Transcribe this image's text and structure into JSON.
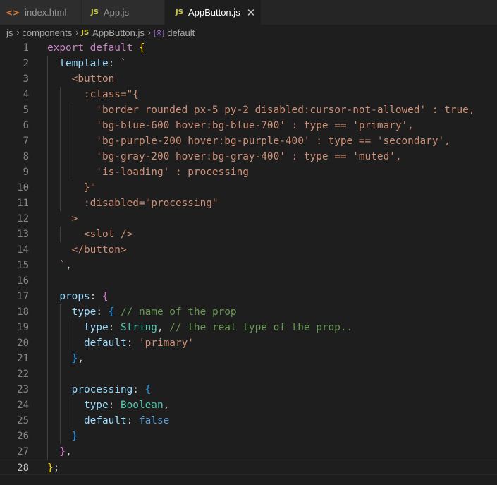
{
  "tabs": [
    {
      "icon": "<>",
      "label": "index.html",
      "active": false
    },
    {
      "icon": "JS",
      "label": "App.js",
      "active": false
    },
    {
      "icon": "JS",
      "label": "AppButton.js",
      "active": true
    }
  ],
  "breadcrumb": {
    "seg1": "js",
    "seg2": "components",
    "file_icon": "JS",
    "file": "AppButton.js",
    "symbol": "default"
  },
  "lines": [
    {
      "n": "1",
      "tokens": [
        [
          "export",
          "kw"
        ],
        [
          " ",
          ""
        ],
        [
          "default",
          "kw"
        ],
        [
          " ",
          ""
        ],
        [
          "{",
          "br1"
        ]
      ]
    },
    {
      "n": "2",
      "tokens": [
        [
          "  ",
          ""
        ],
        [
          "template",
          "prop"
        ],
        [
          ": ",
          ""
        ],
        [
          "`",
          "str"
        ]
      ]
    },
    {
      "n": "3",
      "tokens": [
        [
          "    <button",
          "str"
        ]
      ]
    },
    {
      "n": "4",
      "tokens": [
        [
          "      :class=\"{",
          "str"
        ]
      ]
    },
    {
      "n": "5",
      "tokens": [
        [
          "        'border rounded px-5 py-2 disabled:cursor-not-allowed' : true,",
          "str"
        ]
      ]
    },
    {
      "n": "6",
      "tokens": [
        [
          "        'bg-blue-600 hover:bg-blue-700' : type == 'primary',",
          "str"
        ]
      ]
    },
    {
      "n": "7",
      "tokens": [
        [
          "        'bg-purple-200 hover:bg-purple-400' : type == 'secondary',",
          "str"
        ]
      ]
    },
    {
      "n": "8",
      "tokens": [
        [
          "        'bg-gray-200 hover:bg-gray-400' : type == 'muted',",
          "str"
        ]
      ]
    },
    {
      "n": "9",
      "tokens": [
        [
          "        'is-loading' : processing",
          "str"
        ]
      ]
    },
    {
      "n": "10",
      "tokens": [
        [
          "      }\"",
          "str"
        ]
      ]
    },
    {
      "n": "11",
      "tokens": [
        [
          "      :disabled=\"processing\"",
          "str"
        ]
      ]
    },
    {
      "n": "12",
      "tokens": [
        [
          "    >",
          "str"
        ]
      ]
    },
    {
      "n": "13",
      "tokens": [
        [
          "      <slot />",
          "str"
        ]
      ]
    },
    {
      "n": "14",
      "tokens": [
        [
          "    </button>",
          "str"
        ]
      ]
    },
    {
      "n": "15",
      "tokens": [
        [
          "  `",
          "str"
        ],
        [
          ",",
          ""
        ]
      ]
    },
    {
      "n": "16",
      "tokens": []
    },
    {
      "n": "17",
      "tokens": [
        [
          "  ",
          ""
        ],
        [
          "props",
          "prop"
        ],
        [
          ": ",
          ""
        ],
        [
          "{",
          "br2"
        ]
      ]
    },
    {
      "n": "18",
      "tokens": [
        [
          "    ",
          ""
        ],
        [
          "type",
          "prop"
        ],
        [
          ": ",
          ""
        ],
        [
          "{",
          "br3"
        ],
        [
          " ",
          ""
        ],
        [
          "// name of the prop",
          "com"
        ]
      ]
    },
    {
      "n": "19",
      "tokens": [
        [
          "      ",
          ""
        ],
        [
          "type",
          "prop"
        ],
        [
          ": ",
          ""
        ],
        [
          "String",
          "type"
        ],
        [
          ", ",
          ""
        ],
        [
          "// the real type of the prop..",
          "com"
        ]
      ]
    },
    {
      "n": "20",
      "tokens": [
        [
          "      ",
          ""
        ],
        [
          "default",
          "prop"
        ],
        [
          ": ",
          ""
        ],
        [
          "'primary'",
          "str"
        ]
      ]
    },
    {
      "n": "21",
      "tokens": [
        [
          "    ",
          ""
        ],
        [
          "}",
          "br3"
        ],
        [
          ",",
          ""
        ]
      ]
    },
    {
      "n": "22",
      "tokens": []
    },
    {
      "n": "23",
      "tokens": [
        [
          "    ",
          ""
        ],
        [
          "processing",
          "prop"
        ],
        [
          ": ",
          ""
        ],
        [
          "{",
          "br3"
        ]
      ]
    },
    {
      "n": "24",
      "tokens": [
        [
          "      ",
          ""
        ],
        [
          "type",
          "prop"
        ],
        [
          ": ",
          ""
        ],
        [
          "Boolean",
          "type"
        ],
        [
          ",",
          ""
        ]
      ]
    },
    {
      "n": "25",
      "tokens": [
        [
          "      ",
          ""
        ],
        [
          "default",
          "prop"
        ],
        [
          ": ",
          ""
        ],
        [
          "false",
          "kw2"
        ]
      ]
    },
    {
      "n": "26",
      "tokens": [
        [
          "    ",
          ""
        ],
        [
          "}",
          "br3"
        ]
      ]
    },
    {
      "n": "27",
      "tokens": [
        [
          "  ",
          ""
        ],
        [
          "}",
          "br2"
        ],
        [
          ",",
          ""
        ]
      ]
    },
    {
      "n": "28",
      "tokens": [
        [
          "}",
          "br1"
        ],
        [
          ";",
          ""
        ]
      ]
    }
  ]
}
